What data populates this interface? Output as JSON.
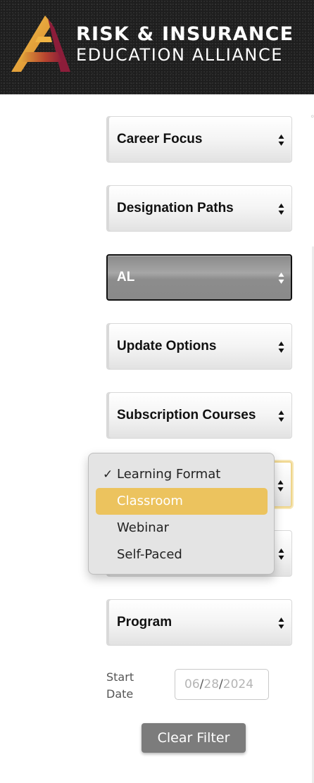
{
  "header": {
    "brand_line1": "RISK & INSURANCE",
    "brand_line2": "EDUCATION ALLIANCE",
    "logo_icon": "triangle-logo-icon"
  },
  "filters": {
    "career_focus": "Career Focus",
    "designation_paths": "Designation Paths",
    "state": "AL",
    "update_options": "Update Options",
    "subscription_courses": "Subscription Courses",
    "learning_format": "Learning Format",
    "hidden_select": "",
    "program": "Program"
  },
  "learning_format_menu": {
    "check_mark": "✓",
    "options": [
      "Learning Format",
      "Classroom",
      "Webinar",
      "Self-Paced"
    ],
    "checked": "Learning Format",
    "highlighted": "Classroom"
  },
  "start_date": {
    "label": "Start Date",
    "month": "06",
    "day": "28",
    "year": "2024",
    "separator": "/"
  },
  "clear_filter_label": "Clear Filter",
  "colors": {
    "header_bg": "#1e1e1e",
    "highlight": "#ecc35e",
    "logo_gold": "#e3a93a",
    "logo_maroon": "#8c1d3a",
    "button_bg": "#7c7c7c"
  }
}
